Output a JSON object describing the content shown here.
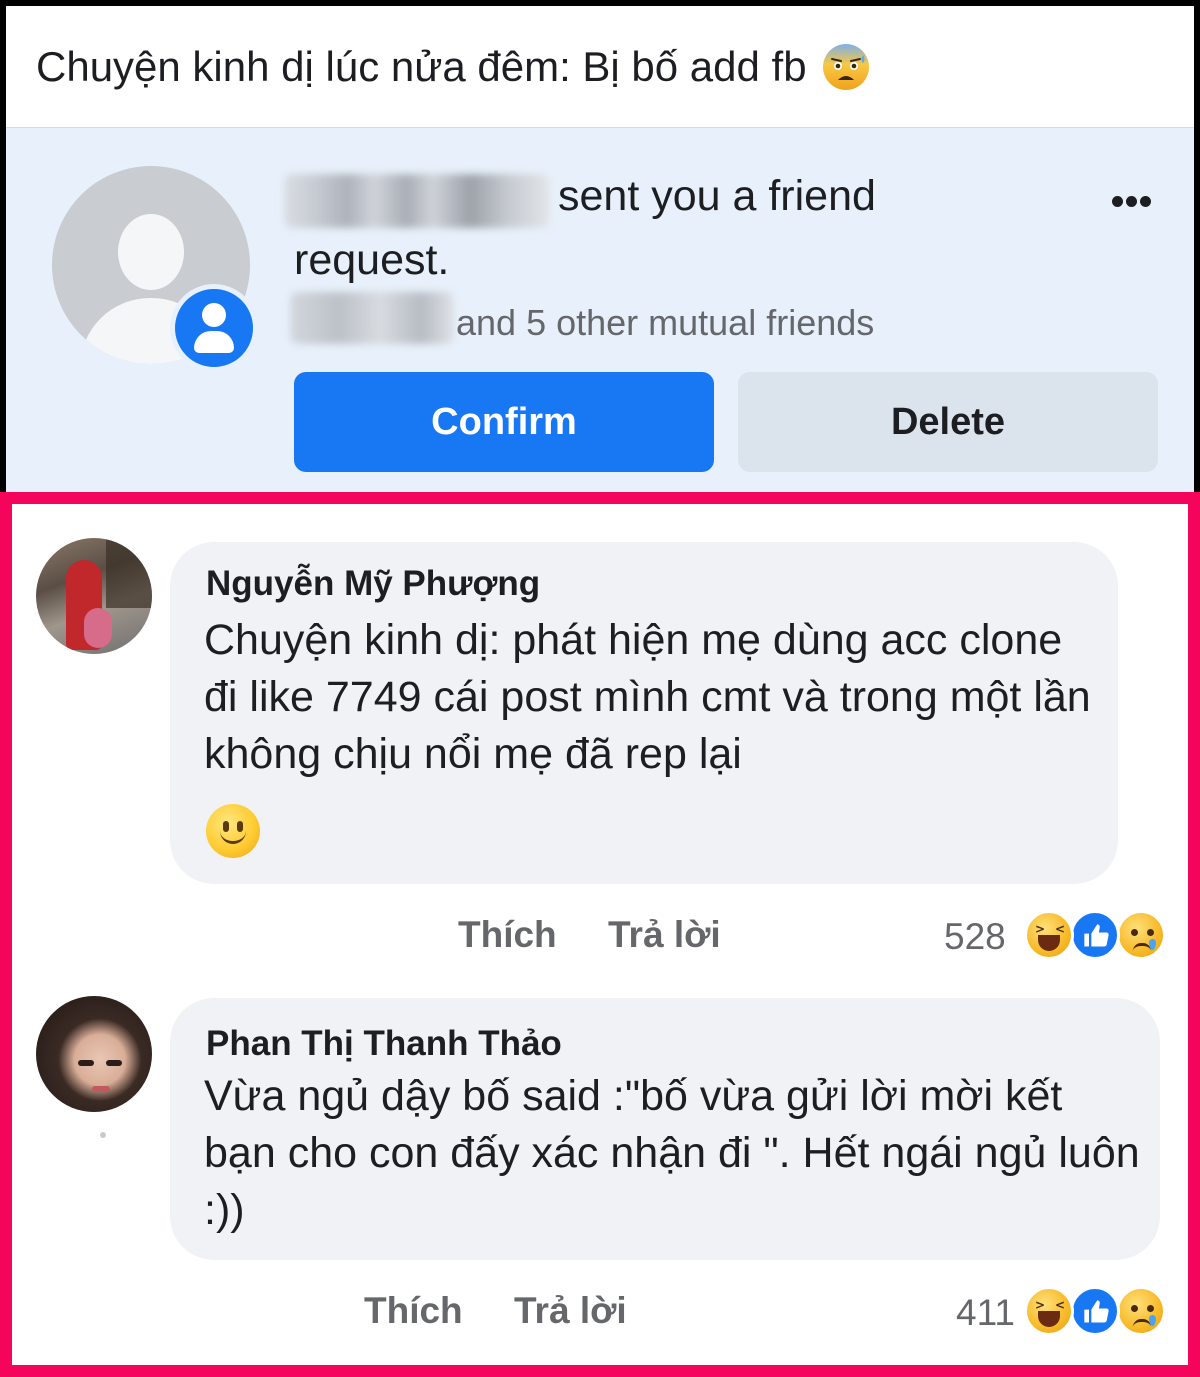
{
  "post": {
    "title": "Chuyện kinh dị lúc nửa đêm: Bị bố add fb",
    "title_emoji": "anxious-face-with-sweat-icon"
  },
  "friend_request": {
    "message_part1": "sent you a friend",
    "message_part2": "request.",
    "mutual_friends": "and 5 other mutual friends",
    "confirm_label": "Confirm",
    "delete_label": "Delete",
    "colors": {
      "confirm_bg": "#1877f2",
      "delete_bg": "#dbe3ec",
      "panel_bg": "#e8f1fb"
    }
  },
  "comments": [
    {
      "author": "Nguyễn Mỹ Phượng",
      "text": "Chuyện kinh dị: phát hiện mẹ dùng acc clone đi like 7749 cái post mình cmt và trong một lần không chịu nổi mẹ đã rep lại",
      "trailing_emoji": "slightly-smiling-face-icon",
      "like_label": "Thích",
      "reply_label": "Trả lời",
      "reaction_count": "528",
      "reactions": [
        "haha-reaction-icon",
        "like-reaction-icon",
        "sad-reaction-icon"
      ]
    },
    {
      "author": "Phan Thị Thanh Thảo",
      "text": "Vừa ngủ dậy bố said :\"bố vừa gửi lời mời kết bạn cho con đấy xác nhận đi \". Hết ngái ngủ luôn :))",
      "like_label": "Thích",
      "reply_label": "Trả lời",
      "reaction_count": "411",
      "reactions": [
        "haha-reaction-icon",
        "like-reaction-icon",
        "sad-reaction-icon"
      ]
    }
  ],
  "frame_color": "#f5045c"
}
